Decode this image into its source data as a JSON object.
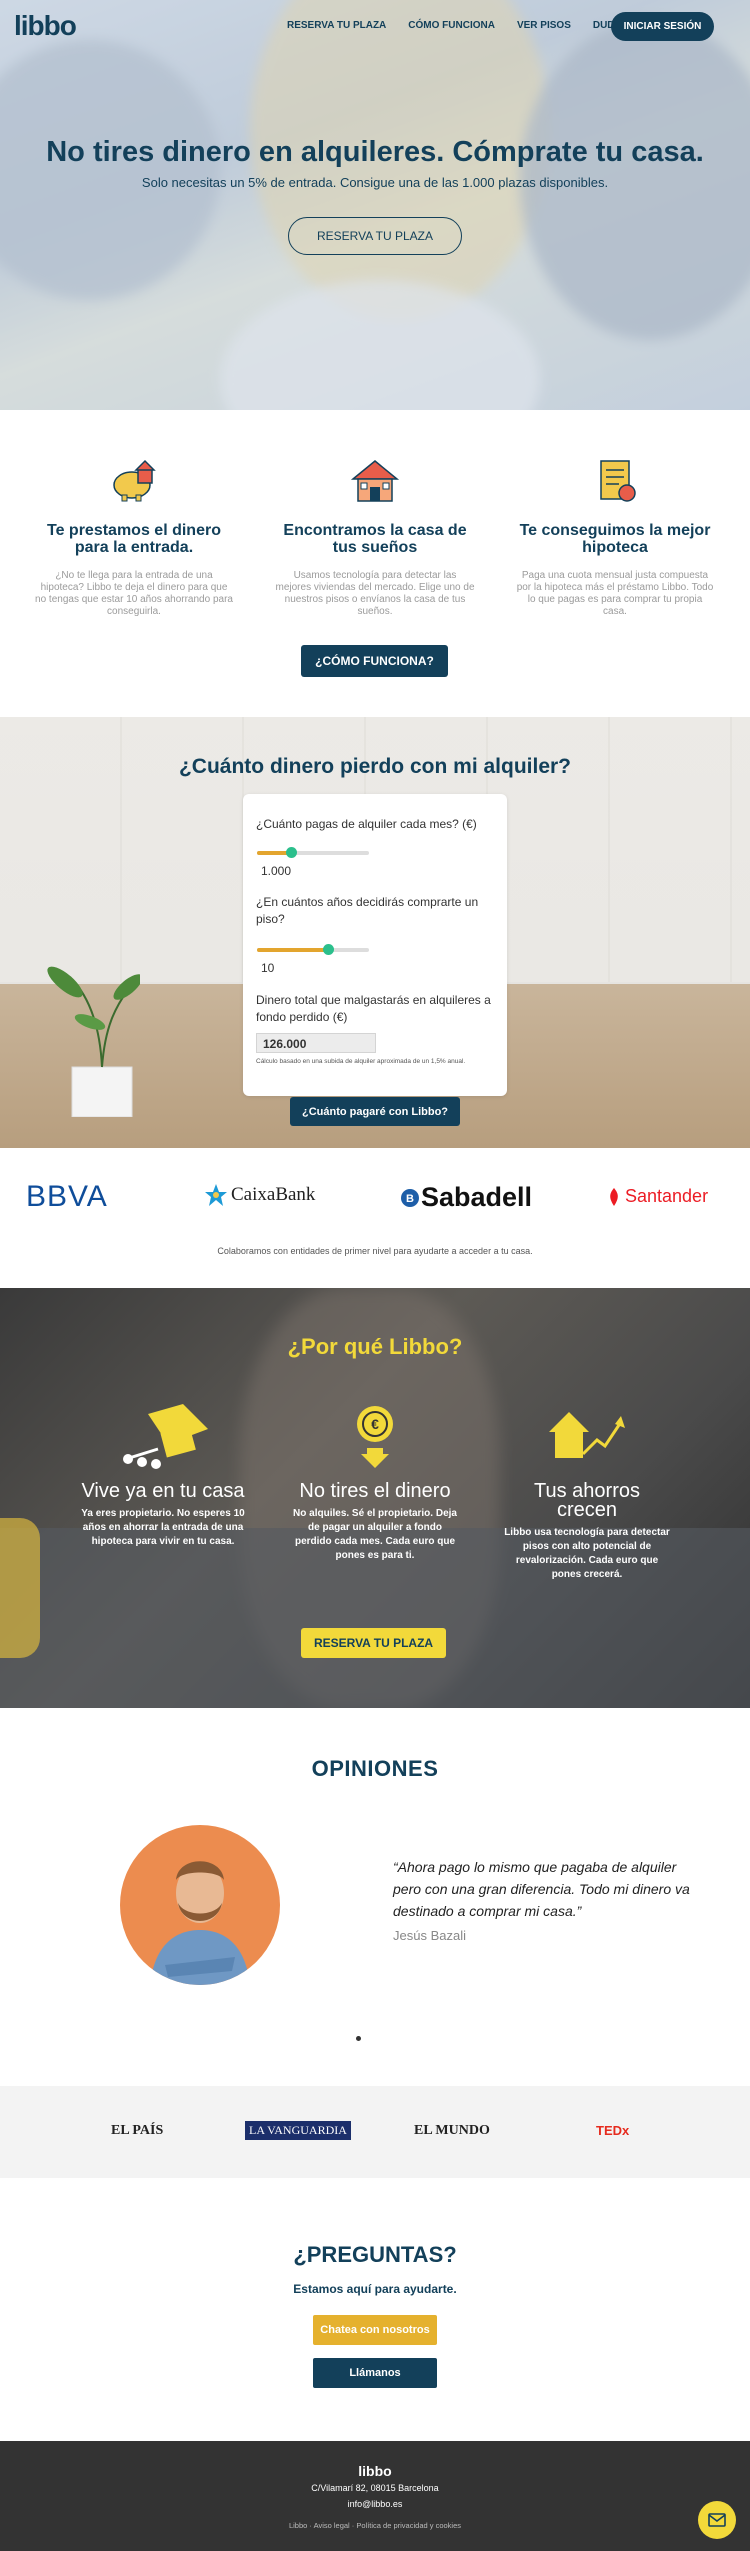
{
  "nav": {
    "logo": "libbo",
    "links": [
      "RESERVA TU PLAZA",
      "CÓMO FUNCIONA",
      "VER PISOS",
      "DUDAS"
    ],
    "login": "INICIAR SESIÓN"
  },
  "hero": {
    "title": "No tires dinero en alquileres. Cómprate tu casa.",
    "subtitle": "Solo necesitas un 5% de entrada. Consigue una de las 1.000 plazas disponibles.",
    "cta": "RESERVA TU PLAZA"
  },
  "features": {
    "items": [
      {
        "icon": "piggy-bank-house-icon",
        "title": "Te prestamos el dinero para la entrada.",
        "text": "¿No te llega para la entrada de una hipoteca? Libbo te deja el dinero para que no tengas que estar 10 años ahorrando para conseguirla."
      },
      {
        "icon": "house-icon",
        "title": "Encontramos la casa de tus sueños",
        "text": "Usamos tecnología para detectar las mejores viviendas del mercado. Elige uno de nuestros pisos o envíanos la casa de tus sueños."
      },
      {
        "icon": "contract-icon",
        "title": "Te conseguimos la mejor hipoteca",
        "text": "Paga una cuota mensual justa compuesta por la hipoteca más el préstamo Libbo.  Todo lo que pagas es para comprar tu propia casa."
      }
    ],
    "cta": "¿CÓMO FUNCIONA?"
  },
  "calculator": {
    "title": "¿Cuánto dinero pierdo con mi alquiler?",
    "q1": "¿Cuánto pagas de alquiler cada mes? (€)",
    "rent_value": "1.000",
    "rent_level": 0.3,
    "q2": "¿En cuántos años decidirás comprarte un piso?",
    "years_value": "10",
    "years_level": 0.63,
    "total_label": "Dinero total que malgastarás en alquileres a fondo perdido (€)",
    "total_value": "126.000",
    "note": "Cálculo basado en una subida de alquiler aproximada de un 1,5% anual.",
    "cta": "¿Cuánto pagaré con Libbo?"
  },
  "banks": {
    "names": [
      "BBVA",
      "CaixaBank",
      "Sabadell",
      "Santander"
    ],
    "caption": "Colaboramos con entidades de primer nivel para ayudarte a acceder a tu casa."
  },
  "why": {
    "title": "¿Por qué Libbo?",
    "items": [
      {
        "icon": "house-keys-icon",
        "title": "Vive ya en tu casa",
        "text": "Ya eres propietario. No esperes 10 años en ahorrar la entrada de una hipoteca para vivir en tu casa."
      },
      {
        "icon": "euro-coin-icon",
        "title": "No tires el dinero",
        "text": "No alquiles. Sé el propietario. Deja de pagar un alquiler a fondo perdido cada mes. Cada euro que pones es para ti."
      },
      {
        "icon": "growth-house-icon",
        "title": "Tus ahorros crecen",
        "text": "Libbo usa tecnología para detectar pisos con alto potencial de revalorización. Cada euro que pones crecerá."
      }
    ],
    "cta": "RESERVA TU PLAZA"
  },
  "opinions": {
    "title": "OPINIONES",
    "quote": "“Ahora pago lo mismo que pagaba de alquiler pero con una gran diferencia. Todo mi dinero va destinado a comprar mi casa.”",
    "author": "Jesús Bazali"
  },
  "press": {
    "names": [
      "EL PAÍS",
      "LA VANGUARDIA",
      "EL MUNDO",
      "TEDx"
    ]
  },
  "contact": {
    "title": "¿PREGUNTAS?",
    "subtitle": "Estamos aquí para ayudarte.",
    "chat": "Chatea con nosotros",
    "call": "Llámanos"
  },
  "footer": {
    "logo": "libbo",
    "address": "C/Vilamarí 82, 08015 Barcelona",
    "email": "info@libbo.es",
    "links": "Libbo  ·  Aviso legal  ·  Política de privacidad y cookies"
  },
  "colors": {
    "primary": "#13405a",
    "accent_yellow": "#f2d93a",
    "accent_orange": "#e5b12e",
    "slider_knob": "#2bbf8c"
  }
}
